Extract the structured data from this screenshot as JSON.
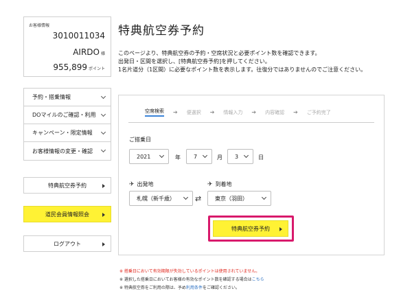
{
  "member": {
    "label": "お客様情報",
    "number": "3010011034",
    "name": "AIRDO",
    "name_suffix": "様",
    "points": "955,899",
    "points_unit": "ポイント"
  },
  "sidebar": {
    "menu": [
      {
        "label": "予約・搭乗情報"
      },
      {
        "label": "DOマイルのご確認・利用"
      },
      {
        "label": "キャンペーン・限定情報"
      },
      {
        "label": "お客様情報の変更・確認"
      }
    ],
    "award_button": "特典航空券予約",
    "dominmin_button": "道民会員情報照会",
    "logout_button": "ログアウト",
    "highlight_color": "#fff234"
  },
  "main": {
    "title": "特典航空券予約",
    "description": [
      "このページより、特典航空券の予約・空席状況と必要ポイント数を確認できます。",
      "出発日・区間を選択し、[特典航空券予約]を押してください。",
      "1名片道分（1区間）に必要なポイント数を表示します。往復分ではありませんのでご注意ください。"
    ]
  },
  "steps": [
    {
      "label": "空席検索",
      "active": true
    },
    {
      "label": "便選択",
      "active": false
    },
    {
      "label": "情報入力",
      "active": false
    },
    {
      "label": "内容確認",
      "active": false
    },
    {
      "label": "ご予約完了",
      "active": false
    }
  ],
  "form": {
    "date_label": "ご搭乗日",
    "year": "2021",
    "year_unit": "年",
    "month": "7",
    "month_unit": "月",
    "day": "3",
    "day_unit": "日",
    "departure_label": "出発地",
    "departure_value": "札幌（新千歳）",
    "arrival_label": "到着地",
    "arrival_value": "東京（羽田）",
    "swap_icon": "⇄",
    "submit_label": "特典航空券予約"
  },
  "notes": {
    "note1": "※ 搭乗日において有効期限が失効しているポイントは使用されていません。",
    "note2_prefix": "※ 選択した搭乗日においてお客様の有効なポイント数を確認する場合は",
    "note2_link": "こちら",
    "note3_prefix": "※ 特典航空券をご利用の際は、予め",
    "note3_link": "利用条件",
    "note3_suffix": "をご確認ください。"
  },
  "colors": {
    "accent_yellow": "#fff234",
    "highlight_border": "#d8196b",
    "active_step_underline": "#3a83d8",
    "note_red": "#e0251b",
    "link_blue": "#2a6fc2"
  }
}
